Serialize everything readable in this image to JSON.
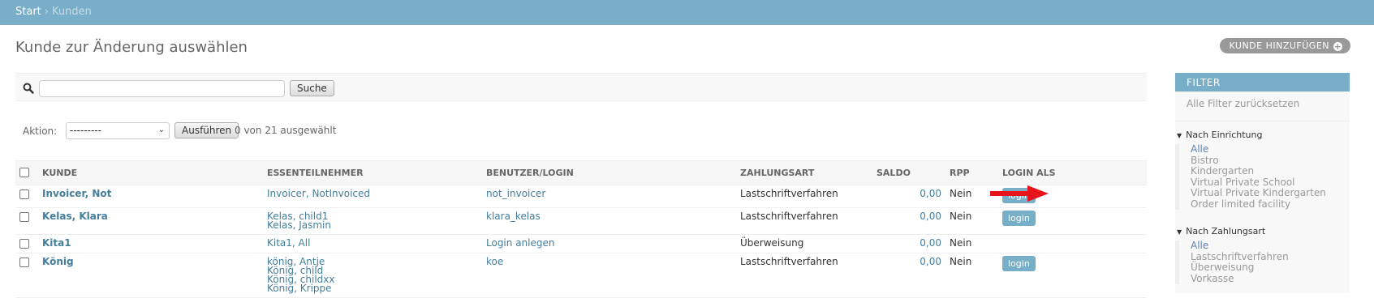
{
  "breadcrumb": {
    "home": "Start",
    "separator": "›",
    "current": "Kunden"
  },
  "title": "Kunde zur Änderung auswählen",
  "add_button": "KUNDE HINZUFÜGEN",
  "search": {
    "value": "",
    "button": "Suche",
    "icon": "search-icon"
  },
  "actions": {
    "label": "Aktion:",
    "selected": "---------",
    "go_button": "Ausführen",
    "counter": "0 von 21 ausgewählt"
  },
  "table": {
    "headers": [
      "KUNDE",
      "ESSENTEILNEHMER",
      "BENUTZER/LOGIN",
      "ZAHLUNGSART",
      "SALDO",
      "RPP",
      "LOGIN ALS"
    ],
    "rows": [
      {
        "kunde": "Invoicer, Not",
        "teilnehmer": [
          "Invoicer, NotInvoiced"
        ],
        "benutzer": "not_invoicer",
        "zahlungsart": "Lastschriftverfahren",
        "saldo": "0,00",
        "rpp": "Nein",
        "login": "login"
      },
      {
        "kunde": "Kelas, Klara",
        "teilnehmer": [
          "Kelas, child1",
          "Kelas, Jasmin"
        ],
        "benutzer": "klara_kelas",
        "zahlungsart": "Lastschriftverfahren",
        "saldo": "0,00",
        "rpp": "Nein",
        "login": "login"
      },
      {
        "kunde": "Kita1",
        "teilnehmer": [
          "Kita1, All"
        ],
        "benutzer": "Login anlegen",
        "zahlungsart": "Überweisung",
        "saldo": "0,00",
        "rpp": "Nein",
        "login": ""
      },
      {
        "kunde": "König",
        "teilnehmer": [
          "könig, Antje",
          "König, child",
          "König, childxx",
          "König, Krippe"
        ],
        "benutzer": "koe",
        "zahlungsart": "Lastschriftverfahren",
        "saldo": "0,00",
        "rpp": "Nein",
        "login": "login"
      }
    ]
  },
  "filter": {
    "title": "FILTER",
    "reset": "Alle Filter zurücksetzen",
    "groups": [
      {
        "title": "Nach Einrichtung",
        "items": [
          "Alle",
          "Bistro",
          "Kindergarten",
          "Virtual Private School",
          "Virtual Private Kindergarten",
          "Order limited facility"
        ]
      },
      {
        "title": "Nach Zahlungsart",
        "items": [
          "Alle",
          "Lastschriftverfahren",
          "Überweisung",
          "Vorkasse"
        ]
      }
    ]
  },
  "colors": {
    "accent": "#79aec8",
    "link": "#447e9b",
    "arrow": "#e8141b"
  }
}
